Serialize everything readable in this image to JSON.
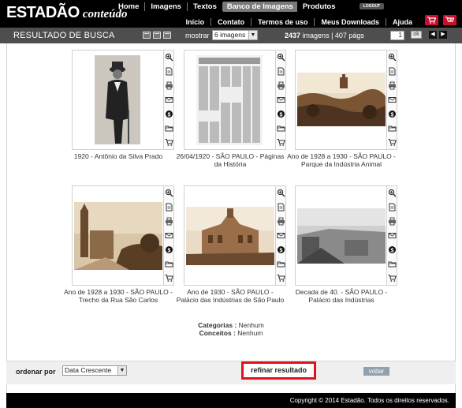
{
  "header": {
    "brand": "ESTADÃO",
    "brand_sub": "conteúdo",
    "nav_primary": [
      {
        "label": "Home"
      },
      {
        "label": "Imagens"
      },
      {
        "label": "Textos"
      },
      {
        "label": "Banco de Imagens",
        "active": true
      },
      {
        "label": "Produtos"
      }
    ],
    "logout_label": "LOGOUT",
    "nav_secondary": [
      {
        "label": "Início"
      },
      {
        "label": "Contato"
      },
      {
        "label": "Termos de uso"
      },
      {
        "label": "Meus Downloads"
      },
      {
        "label": "Ajuda"
      }
    ],
    "accent_color": "#c8102e"
  },
  "toolbar": {
    "title": "RESULTADO DE BUSCA",
    "mostrar_label": "mostrar",
    "per_page": "6 imagens",
    "total_count": "2437",
    "count_suffix": "imagens | 407 págs",
    "page": "1",
    "ok_label": "ok"
  },
  "results": [
    {
      "caption": "1920 - Antônio da Silva Prado"
    },
    {
      "caption": "26/04/1920 - SÃO PAULO - Páginas da História"
    },
    {
      "caption": "Ano de 1928 a 1930 - SÃO PAULO - Parque da Indústria Animal"
    },
    {
      "caption": "Ano de 1928 a 1930 - SÃO PAULO - Trecho da Rua São Carlos"
    },
    {
      "caption": "Ano de 1930 - SÃO PAULO - Palácio das Indústrias de São Paulo"
    },
    {
      "caption": "Decada de 40. - SÃO PAULO - Palácio das Indústrias"
    }
  ],
  "card_actions": [
    "zoom-icon",
    "document-icon",
    "print-icon",
    "email-icon",
    "price-icon",
    "folder-icon",
    "cart-icon"
  ],
  "filters": {
    "categorias_label": "Categorias :",
    "categorias_value": "Nenhum",
    "conceitos_label": "Conceitos :",
    "conceitos_value": "Nenhum"
  },
  "sortbar": {
    "ordenar_label": "ordenar por",
    "order_value": "Data Crescente",
    "refine_label": "refinar resultado",
    "voltar_label": "voltar"
  },
  "footer": {
    "copyright": "Copyright © 2014 Estadão. Todos os direitos reservados."
  }
}
